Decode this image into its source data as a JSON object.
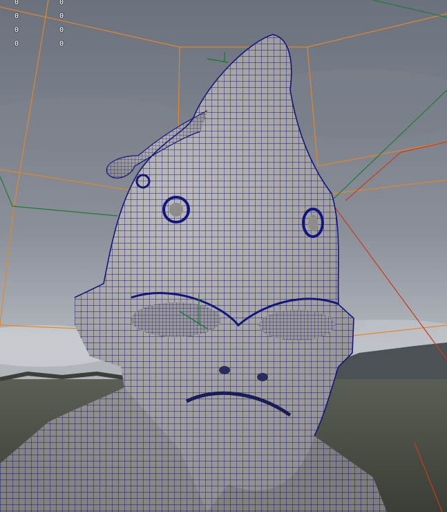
{
  "hud": {
    "column_1": [
      "0",
      "0",
      "0",
      "0"
    ],
    "column_2": [
      "0",
      "0",
      "0",
      "0"
    ]
  },
  "colors": {
    "sky_top": "#6e7480",
    "sky_bottom": "#aeb3bb",
    "mesh_fill": "#a9a7a6",
    "wireframe": "#13157e",
    "grid_orange": "#e3862a",
    "grid_green": "#1e7a34",
    "grid_red": "#c83a1c",
    "ground": "#4a4f44",
    "hills": "#3e4448"
  },
  "icons": [
    "view-axis-icon"
  ]
}
